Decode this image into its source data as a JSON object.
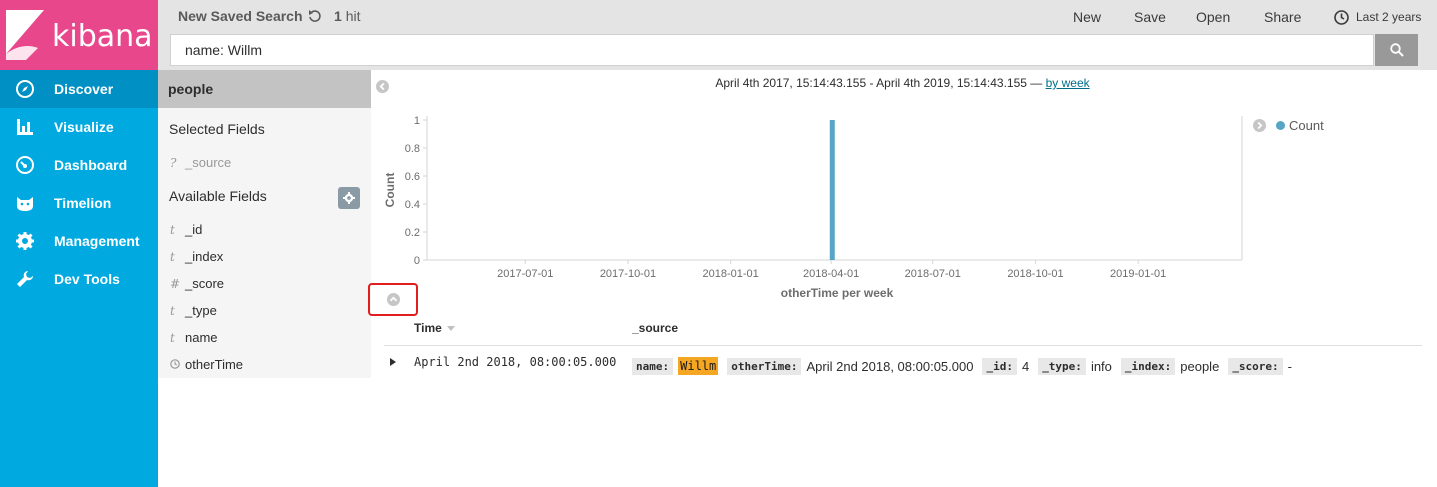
{
  "brand": {
    "name": "kibana",
    "primary_color": "#e8488b",
    "nav_color": "#00a9e0"
  },
  "nav": {
    "items": [
      {
        "label": "Discover",
        "icon": "compass-icon",
        "active": true
      },
      {
        "label": "Visualize",
        "icon": "bar-chart-icon",
        "active": false
      },
      {
        "label": "Dashboard",
        "icon": "gauge-icon",
        "active": false
      },
      {
        "label": "Timelion",
        "icon": "cat-icon",
        "active": false
      },
      {
        "label": "Management",
        "icon": "gear-icon",
        "active": false
      },
      {
        "label": "Dev Tools",
        "icon": "wrench-icon",
        "active": false
      }
    ]
  },
  "topbar": {
    "title": "New Saved Search",
    "hit_count": "1",
    "hit_label": "hit",
    "actions": {
      "new": "New",
      "save": "Save",
      "open": "Open",
      "share": "Share"
    },
    "time_range": "Last 2 years"
  },
  "search": {
    "query": "name: Willm"
  },
  "sidebar": {
    "index_pattern": "people",
    "selected_title": "Selected Fields",
    "selected_fields": [
      {
        "type": "?",
        "name": "_source"
      }
    ],
    "available_title": "Available Fields",
    "available_fields": [
      {
        "type": "t",
        "name": "_id"
      },
      {
        "type": "t",
        "name": "_index"
      },
      {
        "type": "#",
        "name": "_score"
      },
      {
        "type": "t",
        "name": "_type"
      },
      {
        "type": "t",
        "name": "name"
      },
      {
        "type": "clock",
        "name": "otherTime"
      }
    ]
  },
  "histogram": {
    "range_text": "April 4th 2017, 15:14:43.155 - April 4th 2019, 15:14:43.155 —",
    "interval_link": "by week"
  },
  "chart_data": {
    "type": "bar",
    "xlabel": "otherTime per week",
    "ylabel": "Count",
    "x_ticks": [
      "2017-07-01",
      "2017-10-01",
      "2018-01-01",
      "2018-04-01",
      "2018-07-01",
      "2018-10-01",
      "2019-01-01"
    ],
    "y_ticks": [
      0,
      0.2,
      0.4,
      0.6,
      0.8,
      1
    ],
    "ylim": [
      0,
      1
    ],
    "xlim": [
      "2017-04-04",
      "2019-04-04"
    ],
    "series": [
      {
        "name": "Count",
        "color": "#57a5c5",
        "points": [
          {
            "x": "2018-04-02",
            "y": 1
          }
        ]
      }
    ],
    "legend": "top-right",
    "grid": false
  },
  "table": {
    "columns": [
      "Time",
      "_source"
    ],
    "rows": [
      {
        "time": "April 2nd 2018, 08:00:05.000",
        "source": {
          "name_key": "name:",
          "name_val": "Willm",
          "othertime_key": "otherTime:",
          "othertime_val": "April 2nd 2018, 08:00:05.000",
          "id_key": "_id:",
          "id_val": "4",
          "type_key": "_type:",
          "type_val": "info",
          "index_key": "_index:",
          "index_val": "people",
          "score_key": "_score:",
          "score_val": "-"
        }
      }
    ]
  }
}
